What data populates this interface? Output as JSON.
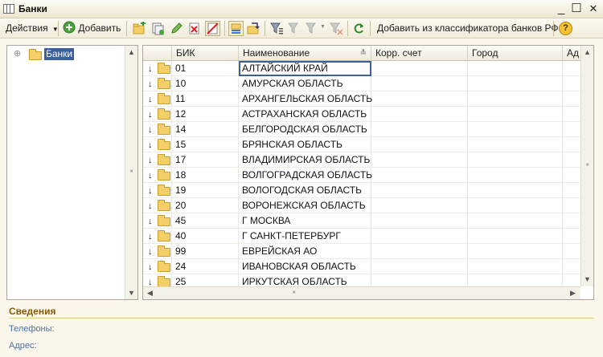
{
  "window": {
    "title": "Банки",
    "min_glyph": "_",
    "max_glyph": "☐",
    "close_glyph": "✕"
  },
  "toolbar": {
    "actions_label": "Действия",
    "add_label": "Добавить",
    "classifier_label": "Добавить из классификатора банков РФ",
    "help_glyph": "?"
  },
  "tree": {
    "expander_glyph": "⊕",
    "root_label": "Банки",
    "selected_color": "#3a5fa0"
  },
  "grid": {
    "columns": [
      "БИК",
      "Наименование",
      "Корр. счет",
      "Город",
      "Ад"
    ],
    "rows": [
      {
        "bik": "01",
        "name": "АЛТАЙСКИЙ КРАЙ",
        "selected": true
      },
      {
        "bik": "10",
        "name": "АМУРСКАЯ ОБЛАСТЬ"
      },
      {
        "bik": "11",
        "name": "АРХАНГЕЛЬСКАЯ ОБЛАСТЬ"
      },
      {
        "bik": "12",
        "name": "АСТРАХАНСКАЯ ОБЛАСТЬ"
      },
      {
        "bik": "14",
        "name": "БЕЛГОРОДСКАЯ ОБЛАСТЬ"
      },
      {
        "bik": "15",
        "name": "БРЯНСКАЯ ОБЛАСТЬ"
      },
      {
        "bik": "17",
        "name": "ВЛАДИМИРСКАЯ ОБЛАСТЬ"
      },
      {
        "bik": "18",
        "name": "ВОЛГОГРАДСКАЯ ОБЛАСТЬ"
      },
      {
        "bik": "19",
        "name": "ВОЛОГОДСКАЯ ОБЛАСТЬ"
      },
      {
        "bik": "20",
        "name": "ВОРОНЕЖСКАЯ ОБЛАСТЬ"
      },
      {
        "bik": "45",
        "name": "Г МОСКВА"
      },
      {
        "bik": "40",
        "name": "Г САНКТ-ПЕТЕРБУРГ"
      },
      {
        "bik": "99",
        "name": "ЕВРЕЙСКАЯ АО"
      },
      {
        "bik": "24",
        "name": "ИВАНОВСКАЯ ОБЛАСТЬ"
      },
      {
        "bik": "25",
        "name": "ИРКУТСКАЯ ОБЛАСТЬ"
      }
    ]
  },
  "details": {
    "title": "Сведения",
    "phones_label": "Телефоны:",
    "address_label": "Адрес:"
  },
  "colors": {
    "accent_title": "#8a5a00",
    "field_label": "#4a6fa8",
    "selection_border": "#3a5fa0"
  },
  "icons": [
    "window-icon",
    "actions-dropdown-icon",
    "add-green-plus-icon",
    "add-folder-icon",
    "copy-icon",
    "edit-pencil-icon",
    "delete-icon",
    "mark-delete-icon",
    "hierarchy-icon",
    "move-to-folder-icon",
    "filter-icon",
    "filter-off-icon",
    "refresh-icon",
    "help-icon"
  ]
}
